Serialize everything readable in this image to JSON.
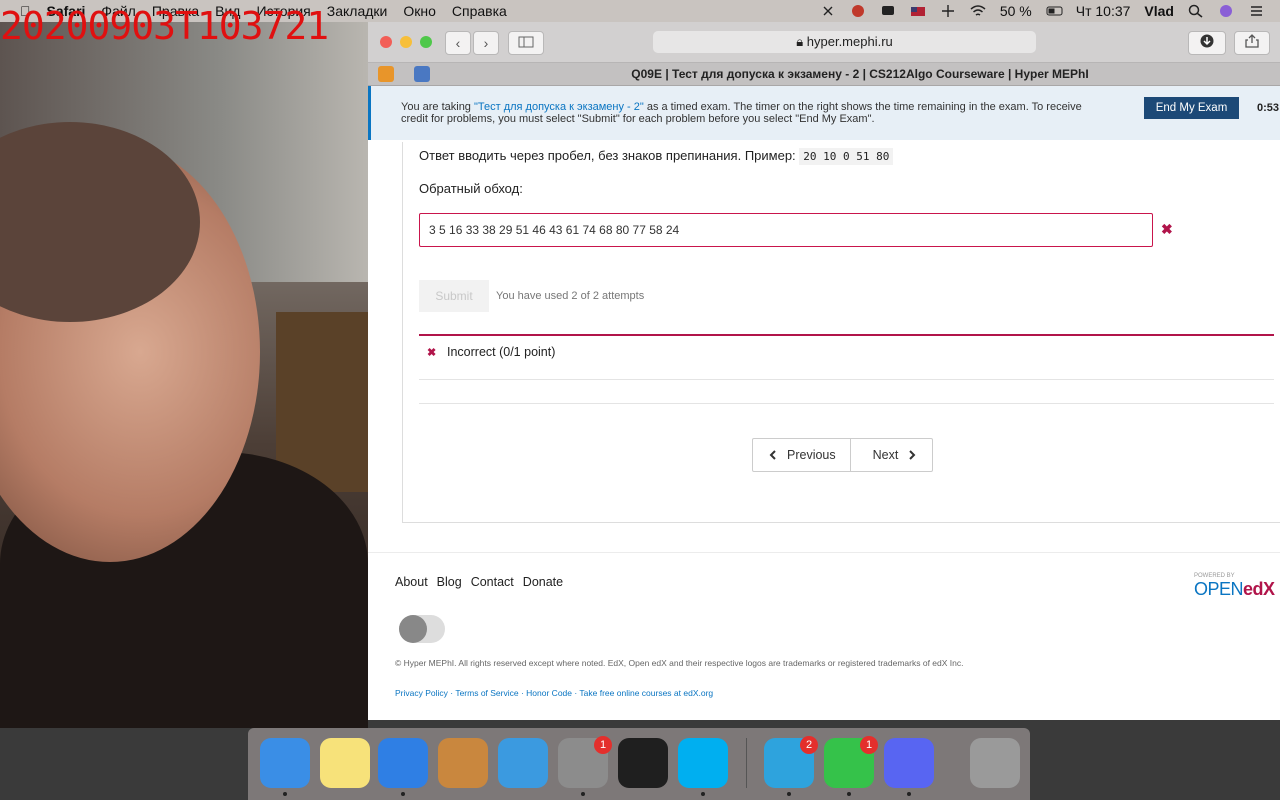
{
  "overlay": {
    "timestamp": "20200903T103721"
  },
  "menubar": {
    "apple": "",
    "app": "Safari",
    "items": [
      "Файл",
      "Правка",
      "Вид",
      "История",
      "Закладки",
      "Окно",
      "Справка"
    ],
    "battery": "50 %",
    "clock": "Чт 10:37",
    "user": "Vlad"
  },
  "browser": {
    "url": "hyper.mephi.ru",
    "tab_title": "Q09E | Тест для допуска к экзамену - 2 | CS212Algo Courseware | Hyper MEPhI"
  },
  "banner": {
    "text_before": "You are taking ",
    "exam_link": "\"Тест для допуска к экзамену - 2\"",
    "text_after": " as a timed exam. The timer on the right shows the time remaining in the exam. To receive credit for problems, you must select \"Submit\" for each problem before you select \"End My Exam\".",
    "end_button": "End My Exam",
    "timer": "0:53:"
  },
  "problem": {
    "instruction": "Ответ вводить через пробел, без знаков препинания. Пример:",
    "example": "20 10 0 51 80",
    "label": "Обратный обход:",
    "answer_value": "3 5 16 33 38 29 51 46 43 61 74 68 80 77 58 24",
    "submit_label": "Submit",
    "attempts": "You have used 2 of 2 attempts",
    "result": "Incorrect (0/1 point)"
  },
  "nav": {
    "previous": "Previous",
    "next": "Next"
  },
  "footer": {
    "links": [
      "About",
      "Blog",
      "Contact",
      "Donate"
    ],
    "copyright": "© Hyper MEPhI. All rights reserved except where noted. EdX, Open edX and their respective logos are trademarks or registered trademarks of edX Inc.",
    "legal": [
      "Privacy Policy",
      "Terms of Service",
      "Honor Code",
      "Take free online courses at edX.org"
    ],
    "powered_by": "POWERED BY",
    "openedx_open": "OPEN",
    "openedx_edx": "edX"
  },
  "dock": {
    "apps": [
      {
        "name": "Finder",
        "color": "#3a8ee6"
      },
      {
        "name": "Notes",
        "color": "#f7e27a"
      },
      {
        "name": "Safari",
        "color": "#2f7fe4"
      },
      {
        "name": "GarageBand",
        "color": "#c9873e"
      },
      {
        "name": "Xcode",
        "color": "#3b9ae0"
      },
      {
        "name": "System Preferences",
        "color": "#8c8c8c",
        "badge": "1"
      },
      {
        "name": "PyCharm",
        "color": "#1f1f1f"
      },
      {
        "name": "Skype",
        "color": "#00aff0"
      },
      {
        "name": "Telegram",
        "color": "#2ea3dd",
        "badge": "2"
      },
      {
        "name": "FaceTime",
        "color": "#35c24a",
        "badge": "1"
      },
      {
        "name": "Discord",
        "color": "#5865f2"
      },
      {
        "name": "Trash",
        "color": "#9a9a9a"
      }
    ]
  }
}
